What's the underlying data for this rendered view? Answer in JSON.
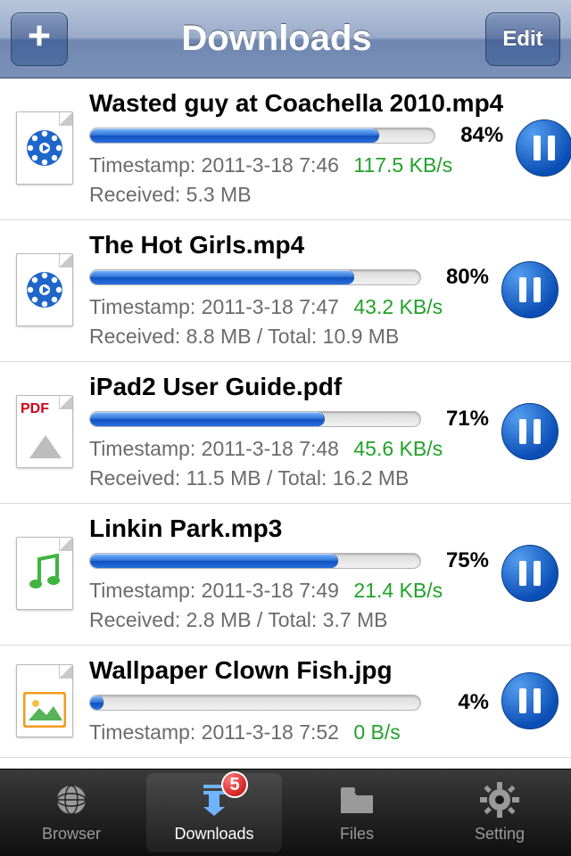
{
  "navbar": {
    "title": "Downloads",
    "edit_label": "Edit"
  },
  "labels": {
    "timestamp_prefix": "Timestamp: ",
    "received_prefix": "Received: ",
    "total_sep": " / Total: "
  },
  "downloads": [
    {
      "icon": "video",
      "name": "Wasted guy at Coachella 2010.mp4",
      "percent": "84%",
      "percent_val": 84,
      "timestamp": "2011-3-18 7:46",
      "speed": "117.5 KB/s",
      "received": "5.3 MB",
      "total": ""
    },
    {
      "icon": "video",
      "name": "The Hot Girls.mp4",
      "percent": "80%",
      "percent_val": 80,
      "timestamp": "2011-3-18 7:47",
      "speed": "43.2 KB/s",
      "received": "8.8 MB",
      "total": "10.9 MB"
    },
    {
      "icon": "pdf",
      "name": "iPad2 User Guide.pdf",
      "percent": "71%",
      "percent_val": 71,
      "timestamp": "2011-3-18 7:48",
      "speed": "45.6 KB/s",
      "received": "11.5 MB",
      "total": "16.2 MB"
    },
    {
      "icon": "audio",
      "name": "Linkin Park.mp3",
      "percent": "75%",
      "percent_val": 75,
      "timestamp": "2011-3-18 7:49",
      "speed": "21.4 KB/s",
      "received": "2.8 MB",
      "total": "3.7 MB"
    },
    {
      "icon": "image",
      "name": "Wallpaper Clown Fish.jpg",
      "percent": "4%",
      "percent_val": 4,
      "timestamp": "2011-3-18 7:52",
      "speed": "0 B/s",
      "received": "",
      "total": ""
    }
  ],
  "tabs": {
    "items": [
      {
        "label": "Browser",
        "icon": "globe"
      },
      {
        "label": "Downloads",
        "icon": "download-arrow",
        "active": true,
        "badge": "5"
      },
      {
        "label": "Files",
        "icon": "folder"
      },
      {
        "label": "Setting",
        "icon": "gear"
      }
    ]
  }
}
